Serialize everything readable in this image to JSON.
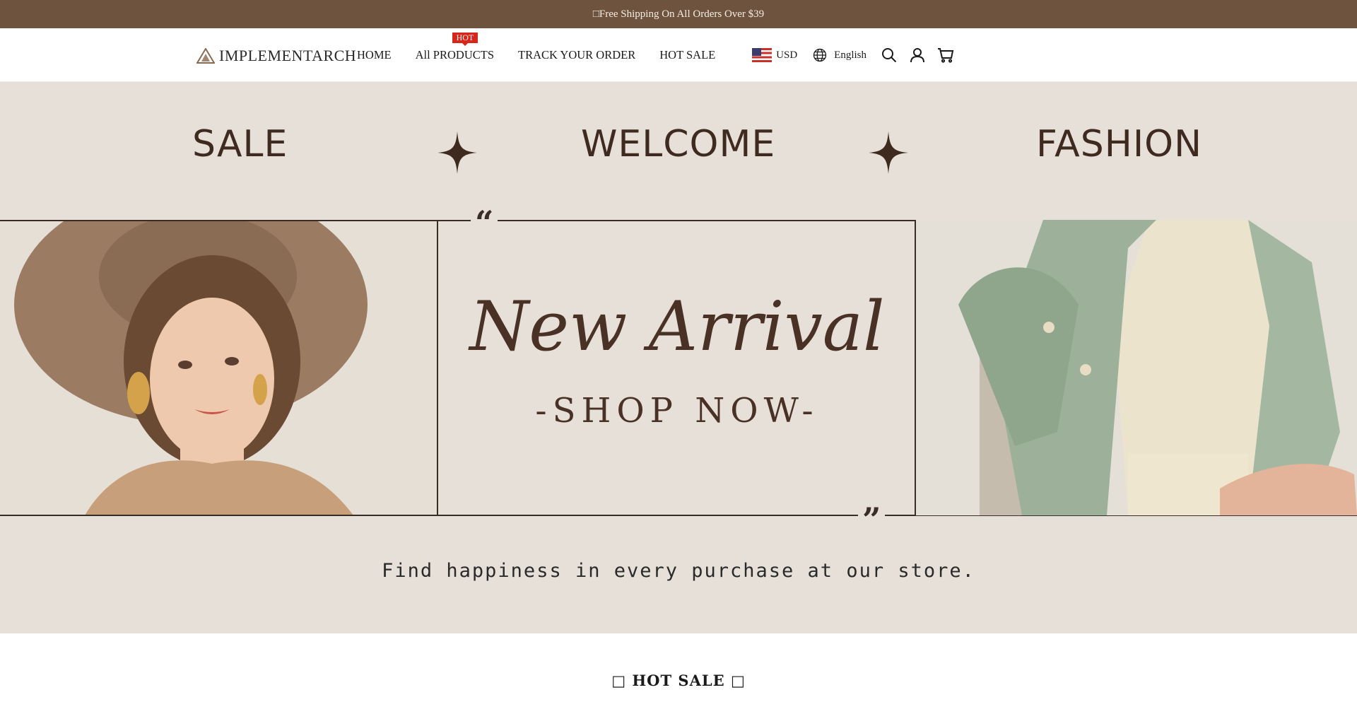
{
  "announcement": {
    "text": "□Free Shipping On All Orders Over $39"
  },
  "header": {
    "logo_text": "IMPLEMENTARCH",
    "nav": [
      {
        "label": "HOME"
      },
      {
        "label": "All PRODUCTS",
        "badge": "HOT"
      },
      {
        "label": "TRACK YOUR ORDER"
      },
      {
        "label": "HOT SALE"
      }
    ],
    "currency": "USD",
    "language": "English",
    "icons": [
      "us-flag-icon",
      "globe-icon",
      "search-icon",
      "account-icon",
      "cart-icon"
    ]
  },
  "hero": {
    "word_left": "SALE",
    "word_center": "WELCOME",
    "word_right": "FASHION",
    "headline": "New Arrival",
    "cta": "-SHOP NOW-",
    "quote_open": "“",
    "quote_close": "”",
    "tagline": "Find happiness in every purchase at our store."
  },
  "section": {
    "title": "□ HOT SALE □"
  },
  "colors": {
    "announcement_bg": "#6e533e",
    "hero_bg": "#e7e0d9",
    "brand_brown": "#4a3125",
    "badge_red": "#d7261b"
  }
}
